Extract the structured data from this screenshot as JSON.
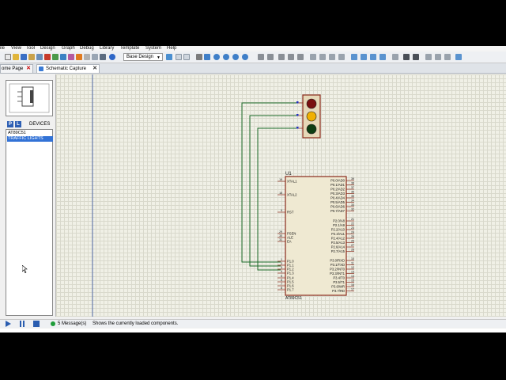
{
  "menu": [
    "ile",
    "View",
    "Tool",
    "Design",
    "Graph",
    "Debug",
    "Library",
    "Template",
    "System",
    "Help"
  ],
  "toolbar": {
    "design_combo": "Base Design"
  },
  "tabs": [
    {
      "label": "ome Page",
      "active": false
    },
    {
      "label": "Schematic Capture",
      "active": true
    }
  ],
  "sidebar": {
    "p_label": "P",
    "l_label": "L",
    "devices_title": "DEVICES",
    "devices": [
      {
        "label": "AT89C51",
        "selected": false
      },
      {
        "label": "TRAFFIC LIGHTS",
        "selected": true
      }
    ]
  },
  "schematic": {
    "chip_ref": "U1",
    "chip_name": "AT89C51",
    "left_pins": [
      {
        "num": "19",
        "name": "XTAL1"
      },
      {
        "num": "18",
        "name": "XTAL2"
      },
      {
        "num": "9",
        "name": "RST"
      },
      {
        "num": "29",
        "name": "PSEN"
      },
      {
        "num": "30",
        "name": "ALE"
      },
      {
        "num": "31",
        "name": "EA"
      },
      {
        "num": "1",
        "name": "P1.0"
      },
      {
        "num": "2",
        "name": "P1.1"
      },
      {
        "num": "3",
        "name": "P1.2"
      },
      {
        "num": "4",
        "name": "P1.3"
      },
      {
        "num": "5",
        "name": "P1.4"
      },
      {
        "num": "6",
        "name": "P1.5"
      },
      {
        "num": "7",
        "name": "P1.6"
      },
      {
        "num": "8",
        "name": "P1.7"
      }
    ],
    "right_pins": [
      {
        "num": "39",
        "name": "P0.0/AD0"
      },
      {
        "num": "38",
        "name": "P0.1/AD1"
      },
      {
        "num": "37",
        "name": "P0.2/AD2"
      },
      {
        "num": "36",
        "name": "P0.3/AD3"
      },
      {
        "num": "35",
        "name": "P0.4/AD4"
      },
      {
        "num": "34",
        "name": "P0.5/AD5"
      },
      {
        "num": "33",
        "name": "P0.6/AD6"
      },
      {
        "num": "32",
        "name": "P0.7/AD7"
      },
      {
        "num": "21",
        "name": "P2.0/A8"
      },
      {
        "num": "22",
        "name": "P2.1/A9"
      },
      {
        "num": "23",
        "name": "P2.2/A10"
      },
      {
        "num": "24",
        "name": "P2.3/A11"
      },
      {
        "num": "25",
        "name": "P2.4/A12"
      },
      {
        "num": "26",
        "name": "P2.5/A13"
      },
      {
        "num": "27",
        "name": "P2.6/A14"
      },
      {
        "num": "28",
        "name": "P2.7/A15"
      },
      {
        "num": "10",
        "name": "P3.0/RXD"
      },
      {
        "num": "11",
        "name": "P3.1/TXD"
      },
      {
        "num": "12",
        "name": "P3.2/INT0"
      },
      {
        "num": "13",
        "name": "P3.3/INT1"
      },
      {
        "num": "14",
        "name": "P3.4/T0"
      },
      {
        "num": "15",
        "name": "P3.5/T1"
      },
      {
        "num": "16",
        "name": "P3.6/WR"
      },
      {
        "num": "17",
        "name": "P3.7/RD"
      }
    ],
    "light_colors": [
      "#7a1010",
      "#f0b000",
      "#0e3d12"
    ],
    "wire_color": "#1d6b2a"
  },
  "status": {
    "messages": "5 Message(s)",
    "text": "Shows the currently loaded components."
  }
}
